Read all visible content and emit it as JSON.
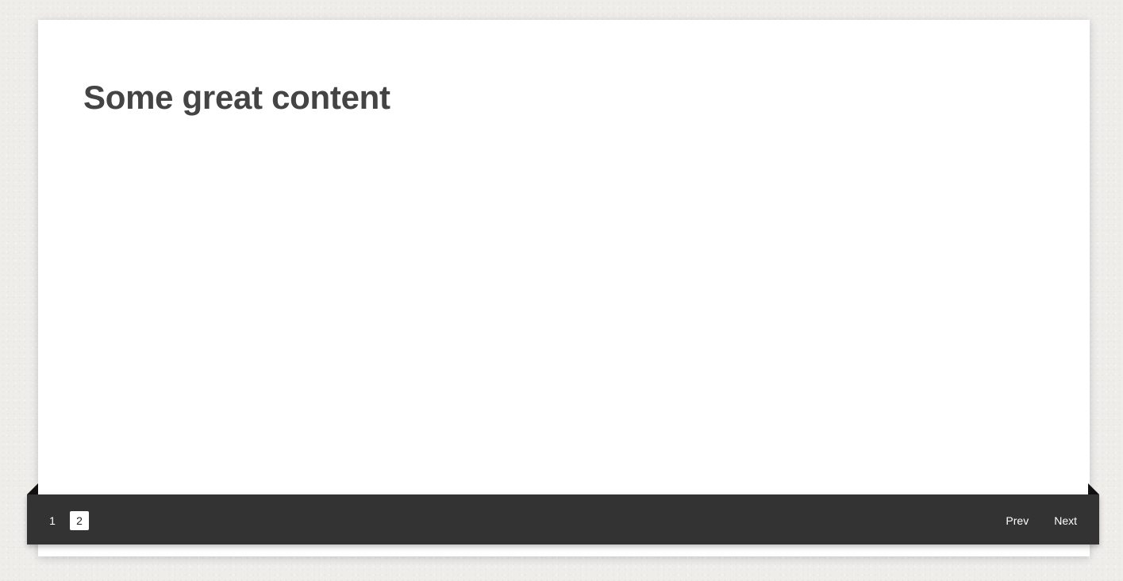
{
  "content": {
    "heading": "Some great content"
  },
  "pagination": {
    "pages": [
      "1",
      "2"
    ],
    "current_page": "2",
    "prev_label": "Prev",
    "next_label": "Next"
  },
  "colors": {
    "background": "#efedea",
    "card": "#ffffff",
    "ribbon": "#333333",
    "heading_text": "#444444"
  }
}
